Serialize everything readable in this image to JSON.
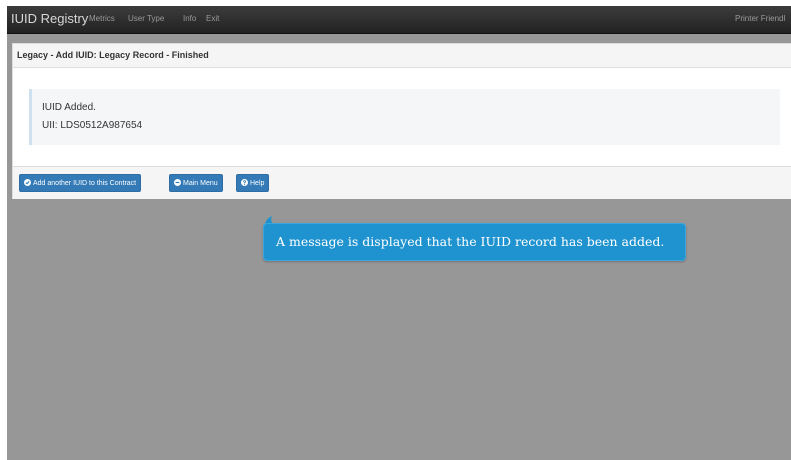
{
  "navbar": {
    "brand": "IUID Registry",
    "links": [
      "Metrics",
      "User Type",
      "Info",
      "Exit"
    ],
    "right_link": "Printer Friendl"
  },
  "panel": {
    "title": "Legacy - Add IUID: Legacy Record - Finished",
    "message": {
      "line1": "IUID Added.",
      "line2": "UII: LDS0512A987654"
    },
    "buttons": {
      "add_another": "Add another IUID to this Contract",
      "main_menu": "Main Menu",
      "help": "Help"
    }
  },
  "tooltip": {
    "text": "A message is displayed that the IUID record has been added."
  },
  "colors": {
    "primary_button": "#337ab7",
    "tooltip": "#1f93cf",
    "overlay": "#979797"
  }
}
